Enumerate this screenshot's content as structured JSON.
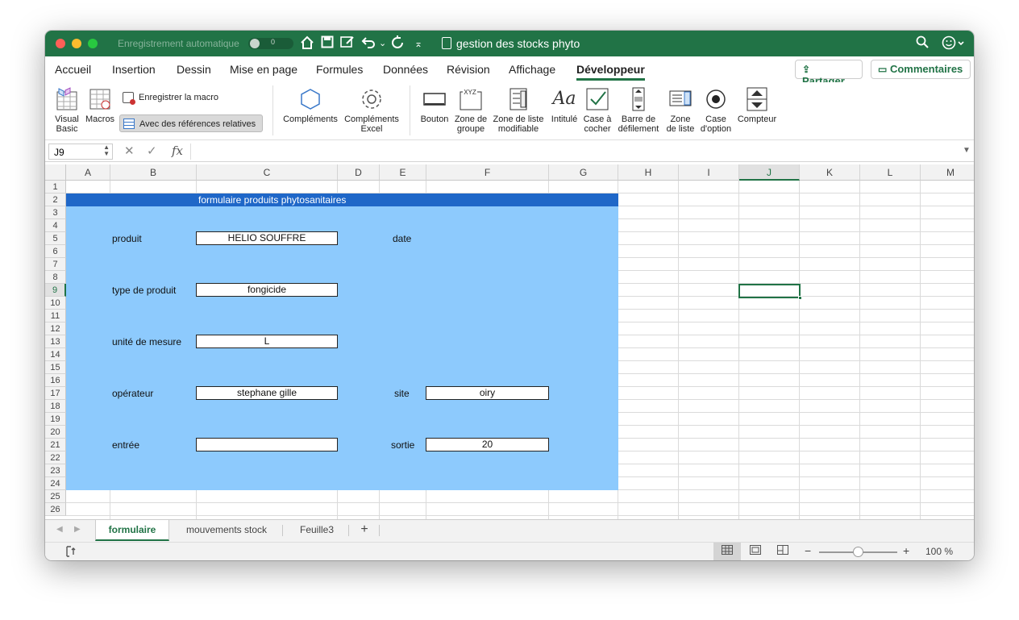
{
  "titlebar": {
    "autosave_label": "Enregistrement automatique",
    "autosave_state": "0",
    "doc_title": "gestion des stocks phyto"
  },
  "menu": {
    "tabs": [
      "Accueil",
      "Insertion",
      "Dessin",
      "Mise en page",
      "Formules",
      "Données",
      "Révision",
      "Affichage",
      "Développeur"
    ],
    "active_tab": "Développeur",
    "share_label": "Partager",
    "comments_label": "Commentaires"
  },
  "ribbon": {
    "visual_basic": "Visual\nBasic",
    "macros": "Macros",
    "record_macro": "Enregistrer la macro",
    "relative_refs": "Avec des références relatives",
    "addins": "Compléments",
    "excel_addins": "Compléments\nExcel",
    "button": "Bouton",
    "group_box": "Zone de\ngroupe",
    "combo_box": "Zone de liste\nmodifiable",
    "label": "Intitulé",
    "checkbox": "Case à\ncocher",
    "scrollbar": "Barre de\ndéfilement",
    "list_box": "Zone\nde liste",
    "option_button": "Case\nd'option",
    "spinner": "Compteur"
  },
  "formula_bar": {
    "name_box": "J9",
    "fx": "fx",
    "value": ""
  },
  "columns": [
    "A",
    "B",
    "C",
    "D",
    "E",
    "F",
    "G",
    "H",
    "I",
    "J",
    "K",
    "L",
    "M"
  ],
  "active_column": "J",
  "rows": [
    "1",
    "2",
    "3",
    "4",
    "5",
    "6",
    "7",
    "8",
    "9",
    "10",
    "11",
    "12",
    "13",
    "14",
    "15",
    "16",
    "17",
    "18",
    "19",
    "20",
    "21",
    "22",
    "23",
    "24",
    "25",
    "26"
  ],
  "active_row": "9",
  "form": {
    "title": "formulaire produits phytosanitaires",
    "produit_label": "produit",
    "produit_value": "HELIO SOUFFRE",
    "date_label": "date",
    "type_label": "type de produit",
    "type_value": "fongicide",
    "unite_label": "unité de mesure",
    "unite_value": "L",
    "operateur_label": "opérateur",
    "operateur_value": "stephane gille",
    "site_label": "site",
    "site_value": "oiry",
    "entree_label": "entrée",
    "entree_value": "",
    "sortie_label": "sortie",
    "sortie_value": "20"
  },
  "sheets": {
    "tabs": [
      "formulaire",
      "mouvements stock",
      "Feuille3"
    ],
    "active": "formulaire",
    "add": "+"
  },
  "status": {
    "zoom": "100 %",
    "zoom_minus": "−",
    "zoom_plus": "+"
  },
  "colors": {
    "excel_green": "#217346",
    "form_background": "#8dcafd",
    "title_band": "#1f67c8"
  }
}
